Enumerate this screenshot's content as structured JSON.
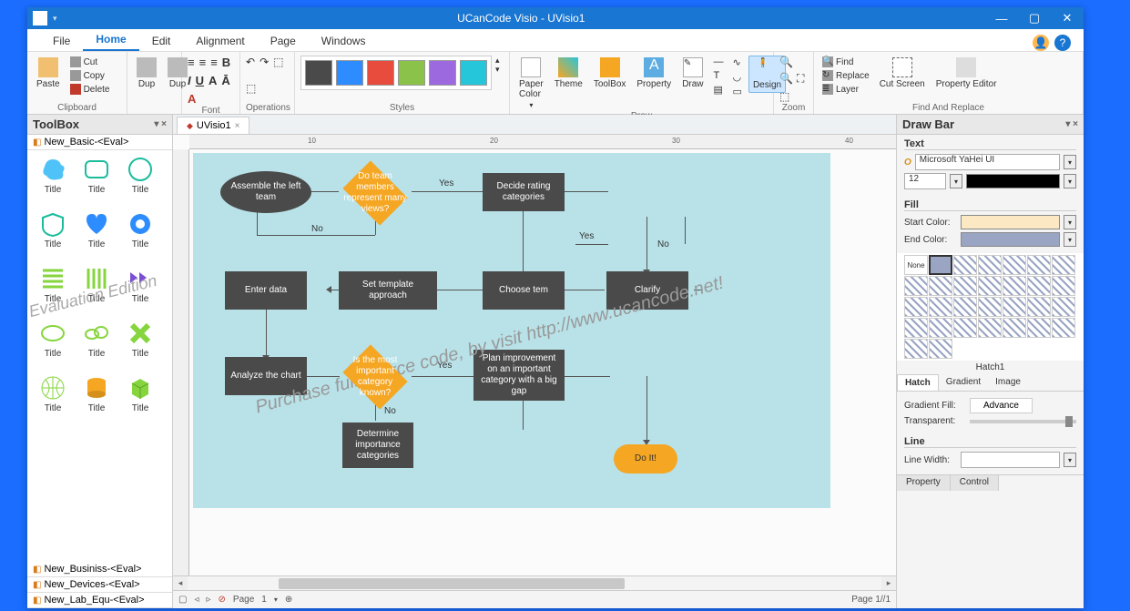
{
  "title": "UCanCode Visio - UVisio1",
  "menu": [
    "File",
    "Home",
    "Edit",
    "Alignment",
    "Page",
    "Windows"
  ],
  "menu_active": 1,
  "ribbon": {
    "clipboard": {
      "paste": "Paste",
      "cut": "Cut",
      "copy": "Copy",
      "delete": "Delete",
      "label": "Clipboard"
    },
    "dup": {
      "btn": "Dup"
    },
    "font": {
      "label": "Font"
    },
    "operations": {
      "label": "Operations"
    },
    "styles": {
      "label": "Styles",
      "colors": [
        "#4a4a4a",
        "#2d8cff",
        "#e74c3c",
        "#8bc34a",
        "#9c6ade",
        "#26c6da"
      ]
    },
    "draw": {
      "paper": "Paper Color",
      "theme": "Theme",
      "toolbox": "ToolBox",
      "property": "Property",
      "drawbtn": "Draw",
      "design": "Design",
      "label": "Draw"
    },
    "zoom": {
      "label": "Zoom"
    },
    "find": {
      "find": "Find",
      "replace": "Replace",
      "layer": "Layer",
      "cut": "Cut Screen",
      "prop": "Property Editor",
      "label": "Find And Replace"
    }
  },
  "toolbox": {
    "title": "ToolBox",
    "categories": [
      "New_Basic-<Eval>",
      "New_Businiss-<Eval>",
      "New_Devices-<Eval>",
      "New_Lab_Equ-<Eval>"
    ],
    "shape_label": "Title",
    "watermark": "Evaluation Edition"
  },
  "tabs": {
    "doc": "UVisio1"
  },
  "ruler_marks": [
    "10",
    "20",
    "30",
    "40"
  ],
  "flow": {
    "assemble": "Assemble the left team",
    "views": "Do team members represent many views?",
    "decide": "Decide rating categories",
    "enter": "Enter data",
    "template": "Set template approach",
    "choose": "Choose tem",
    "clarify": "Clarify",
    "analyze": "Analyze the chart",
    "known": "Is the most important category known?",
    "plan": "Plan improvement on an important category with a big gap",
    "determine": "Determine importance categories",
    "doit": "Do It!",
    "yes": "Yes",
    "no": "No"
  },
  "watermark_canvas": "Purchase full source code, by visit http://www.ucancode.net!",
  "status": {
    "page_label": "Page",
    "page_num": "1",
    "page_of": "Page 1//1"
  },
  "drawbar": {
    "title": "Draw Bar",
    "text": {
      "label": "Text",
      "font": "Microsoft YaHei UI",
      "size": "12"
    },
    "fill": {
      "label": "Fill",
      "start": "Start Color:",
      "end": "End Color:",
      "start_c": "#fce9c4",
      "end_c": "#9aa5c4"
    },
    "hatch": {
      "none": "None",
      "name": "Hatch1",
      "tabs": [
        "Hatch",
        "Gradient",
        "Image"
      ],
      "active": 0
    },
    "gradient": "Gradient Fill:",
    "advance": "Advance",
    "transparent": "Transparent:",
    "line": {
      "label": "Line",
      "width": "Line Width:"
    },
    "footer": [
      "Property",
      "Control"
    ]
  }
}
